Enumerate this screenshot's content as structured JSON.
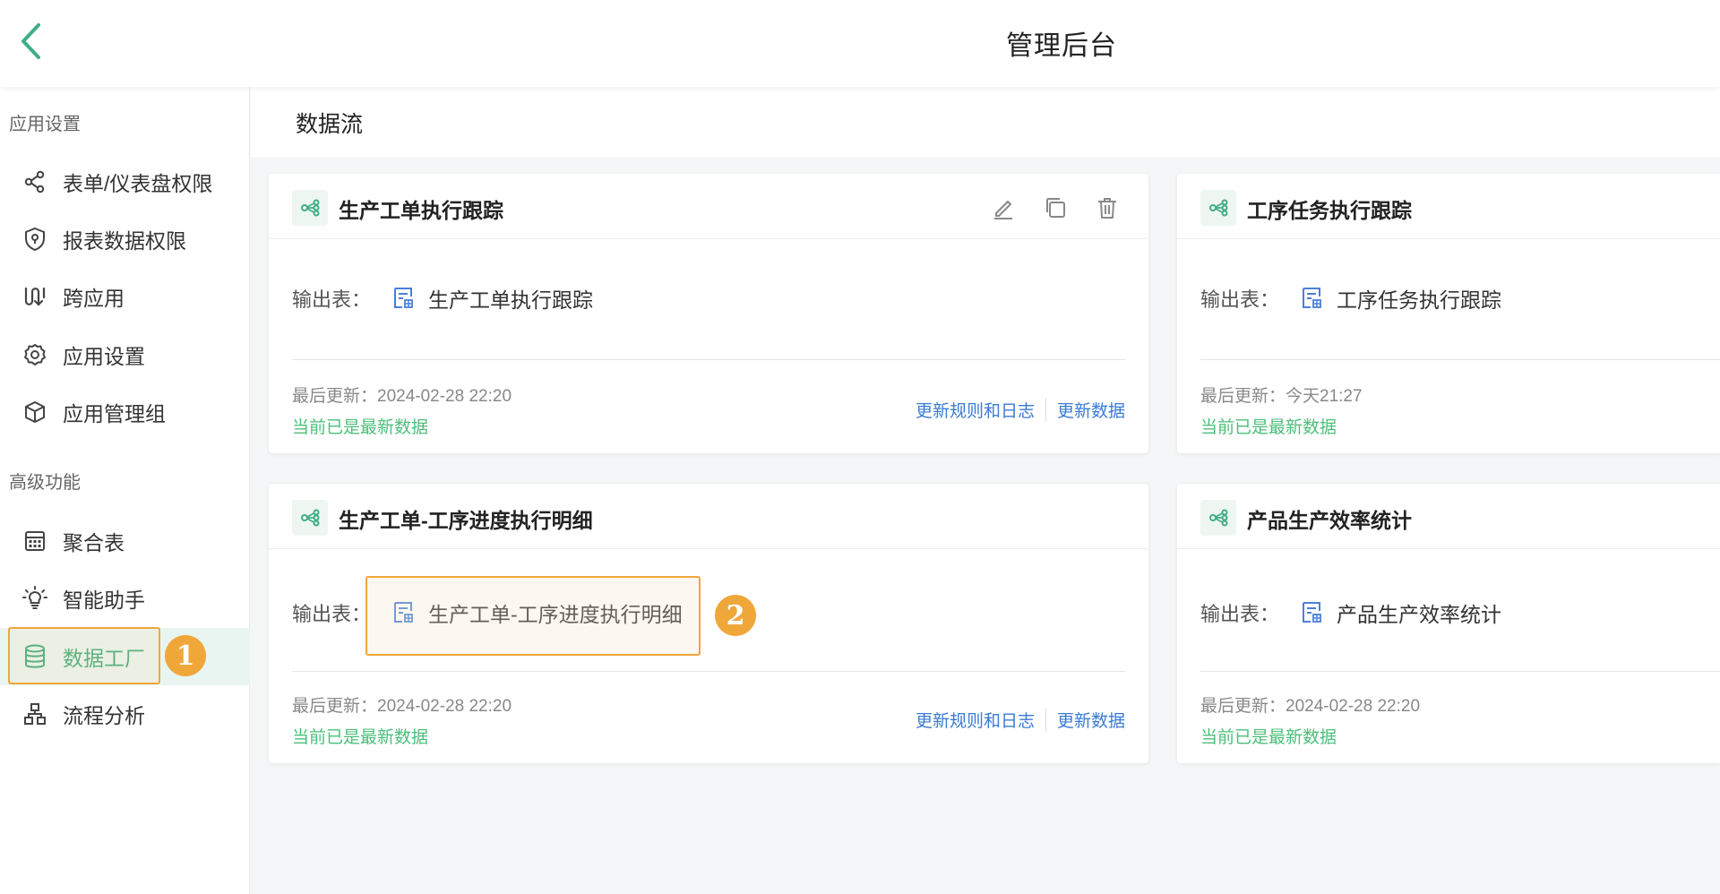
{
  "topbar": {
    "title": "管理后台"
  },
  "sidebar": {
    "groups": [
      {
        "label": "应用设置"
      },
      {
        "label": "高级功能"
      }
    ],
    "items": [
      {
        "label": "表单/仪表盘权限",
        "icon": "share-nodes-icon"
      },
      {
        "label": "报表数据权限",
        "icon": "shield-icon"
      },
      {
        "label": "跨应用",
        "icon": "cross-app-icon"
      },
      {
        "label": "应用设置",
        "icon": "gear-icon"
      },
      {
        "label": "应用管理组",
        "icon": "cube-icon"
      },
      {
        "label": "聚合表",
        "icon": "calculator-icon"
      },
      {
        "label": "智能助手",
        "icon": "lightbulb-icon"
      },
      {
        "label": "数据工厂",
        "icon": "database-icon",
        "active": true
      },
      {
        "label": "流程分析",
        "icon": "org-chart-icon"
      }
    ]
  },
  "annotations": {
    "badge1": "1",
    "badge2": "2"
  },
  "content": {
    "title": "数据流",
    "out_label": "输出表：",
    "cards": [
      {
        "title": "生产工单执行跟踪",
        "output": "生产工单执行跟踪",
        "updated": "最后更新：2024-02-28 22:20",
        "status": "当前已是最新数据",
        "link_rules": "更新规则和日志",
        "link_update": "更新数据"
      },
      {
        "title": "工序任务执行跟踪",
        "output": "工序任务执行跟踪",
        "updated": "最后更新：今天21:27",
        "status": "当前已是最新数据"
      },
      {
        "title": "生产工单-工序进度执行明细",
        "output": "生产工单-工序进度执行明细",
        "updated": "最后更新：2024-02-28 22:20",
        "status": "当前已是最新数据",
        "link_rules": "更新规则和日志",
        "link_update": "更新数据"
      },
      {
        "title": "产品生产效率统计",
        "output": "产品生产效率统计",
        "updated": "最后更新：2024-02-28 22:20",
        "status": "当前已是最新数据"
      }
    ]
  },
  "colors": {
    "accent": "#26a269",
    "link": "#3a7bd5",
    "highlight": "#f0a73a",
    "status_green": "#4cbf7a"
  }
}
